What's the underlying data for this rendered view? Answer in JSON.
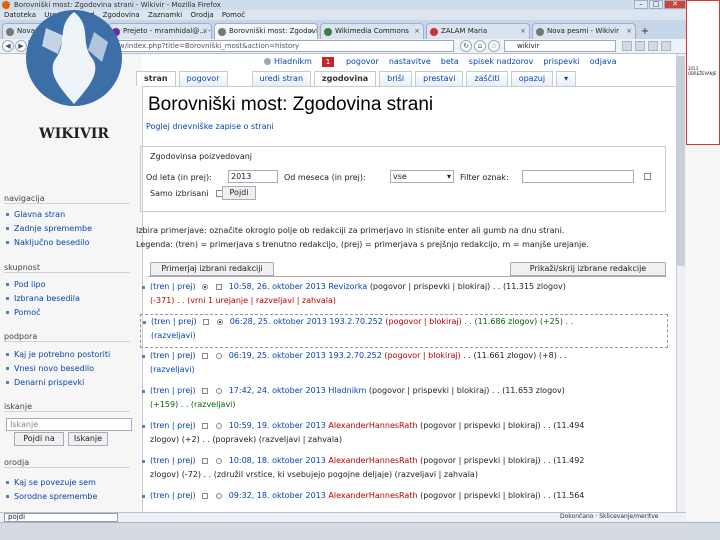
{
  "browser": {
    "title": "Borovniški most: Zgodovina strani - Wikivir - Mozilla Firefox",
    "menu": [
      "Datoteka",
      "Uredi",
      "Pogled",
      "Zgodovina",
      "Zaznamki",
      "Orodja",
      "Pomoč"
    ],
    "tabs": [
      {
        "label": "Nova pesmi - Wikivir",
        "active": false
      },
      {
        "label": "Prejeto - mramhidal@... - Yahoo",
        "active": false
      },
      {
        "label": "Borovniški most: Zgodovina s...",
        "active": true
      },
      {
        "label": "Wikimedia Commons",
        "active": false
      },
      {
        "label": "ZALAM Maria",
        "active": false
      },
      {
        "label": "Nova pesmi - Wikivir",
        "active": false
      }
    ],
    "new_tab": "+",
    "url": "https://sl.wikisource.org/w/index.php?title=Borovniški_most&action=history",
    "search_value": "wikivir",
    "find_value": "pojdi",
    "status_right": "Dokončano · Sklicevanje/meritve",
    "win_min": "–",
    "win_max": "□",
    "win_close": "✕"
  },
  "side_panel": {
    "line1": "2013",
    "line2": "OBREŽEVANJE"
  },
  "sidebar": {
    "logo_text": "WIKIVIR",
    "sections": [
      {
        "heading": "navigacija",
        "items": [
          "Glavna stran",
          "Zadnje spremembe",
          "Naključno besedilo"
        ]
      },
      {
        "heading": "skupnost",
        "items": [
          "Pod lipo",
          "Izbrana besedila",
          "Pomoč"
        ]
      },
      {
        "heading": "podpora",
        "items": [
          "Kaj je potrebno postoriti",
          "Vnesi novo besedilo",
          "Denarni prispevki"
        ]
      }
    ],
    "search_heading": "iskanje",
    "search_placeholder": "Iskanje",
    "search_go": "Pojdi na",
    "search_btn": "Iskanje",
    "tools_heading": "orodja",
    "tools_items": [
      "Kaj se povezuje sem",
      "Sorodne spremembe"
    ]
  },
  "personal": {
    "user": "Hladnikm",
    "notifications": "1",
    "links": [
      "pogovor",
      "nastavitve",
      "beta",
      "spisek nadzorov",
      "prispevki",
      "odjava"
    ]
  },
  "content_tabs": {
    "left": [
      "stran",
      "pogovor"
    ],
    "right": [
      "uredi stran",
      "zgodovina",
      "briši",
      "prestavi",
      "zaščiti",
      "opazuj"
    ],
    "more": "▾"
  },
  "page": {
    "title": "Borovniški most: Zgodovina strani",
    "subtitle": "Poglej dnevniške zapise o strani"
  },
  "filter": {
    "legend": "Zgodovinsa poizvedovanj",
    "year_label": "Od leta (in prej):",
    "year_value": "2013",
    "month_label": "Od meseca (in prej):",
    "month_value": "vse",
    "tag_label": "Filter oznak:",
    "tag_value": "",
    "deleted_label": "Samo izbrisani",
    "go_label": "Pojdi"
  },
  "help": {
    "line1": "Izbira primerjave: označite okroglo polje ob redakciji za primerjavo in stisnite enter ali gumb na dnu strani.",
    "line2": "Legenda: (tren) = primerjava s trenutno redakcijo, (prej) = primerjava s prejšnjo redakcijo, m = manjše urejanje."
  },
  "buttons": {
    "compare": "Primerjaj izbrani redakciji",
    "toggle": "Prikaži/skrij izbrane redakcije"
  },
  "revisions": [
    {
      "l1": "(tren | prej)",
      "date": "10:58, 26. oktober 2013",
      "user": "Revizorka",
      "links": "(pogovor | prispevki | blokiraj)",
      "size": ". . (11.315 zlogov)",
      "l2": "(-371) . . (vrni 1 urejanje | razveljavi | zahvala)",
      "user_red": false
    },
    {
      "l1": "(tren | prej)",
      "date": "06:28, 25. oktober 2013",
      "user": "193.2.70.252",
      "links": "(pogovor | blokiraj)",
      "size": ". . (11.686 zlogov) (+25) . .",
      "l2": "(razveljavi)",
      "user_red": false
    },
    {
      "l1": "(tren | prej)",
      "date": "06:19, 25. oktober 2013",
      "user": "193.2.70.252",
      "links": "(pogovor | blokiraj)",
      "size": ". . (11.661 zlogov) (+8) . .",
      "l2": "(razveljavi)",
      "user_red": false
    },
    {
      "l1": "(tren | prej)",
      "date": "17:42, 24. oktober 2013",
      "user": "Hladnikm",
      "links": "(pogovor | prispevki | blokiraj)",
      "size": ". . (11.653 zlogov)",
      "l2": "(+159) . . (razveljavi)",
      "user_red": false
    },
    {
      "l1": "(tren | prej)",
      "date": "10:59, 19. oktober 2013",
      "user": "AlexanderHannesRath",
      "links": "(pogovor | prispevki | blokiraj)",
      "size": ". . (11.494",
      "l2": "zlogov) (+2) . . (popravek) (razveljavi | zahvala)",
      "user_red": true
    },
    {
      "l1": "(tren | prej)",
      "date": "10:08, 18. oktober 2013",
      "user": "AlexanderHannesRath",
      "links": "(pogovor | prispevki | blokiraj)",
      "size": ". . (11.492",
      "l2": "zlogov) (-72) . . (združil vrstice, ki vsebujejo pogojne deljaje) (razveljavi | zahvala)",
      "user_red": true
    },
    {
      "l1": "(tren | prej)",
      "date": "09:32, 18. oktober 2013",
      "user": "AlexanderHannesRath",
      "links": "(pogovor | prispevki | blokiraj)",
      "size": ". . (11.564",
      "l2": "",
      "user_red": true
    }
  ],
  "colors": {
    "link": "#0645ad",
    "redlink": "#ba0000",
    "positive": "#006400",
    "sidebar_bg": "#f6f6f6"
  }
}
